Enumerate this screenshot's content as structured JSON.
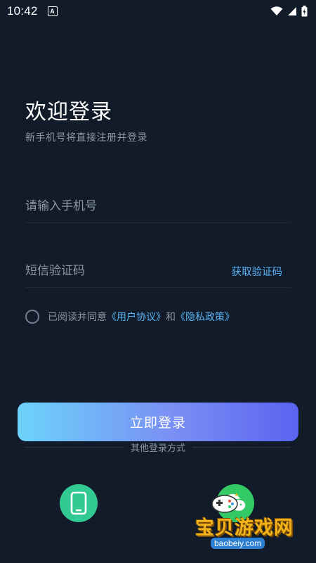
{
  "status_bar": {
    "time": "10:42",
    "notification_letter": "A"
  },
  "header": {
    "title": "欢迎登录",
    "subtitle": "新手机号将直接注册并登录"
  },
  "form": {
    "phone_placeholder": "请输入手机号",
    "code_placeholder": "短信验证码",
    "get_code_label": "获取验证码"
  },
  "agreement": {
    "prefix": "已阅读并同意",
    "user_agreement": "《用户协议》",
    "conjunction": "和",
    "privacy_policy": "《隐私政策》"
  },
  "login_button": {
    "label": "立即登录"
  },
  "other_login": {
    "label": "其他登录方式",
    "methods": [
      {
        "icon": "phone-icon",
        "color": "#33c993"
      },
      {
        "icon": "wechat-icon",
        "color": "#33c964"
      }
    ]
  },
  "watermark": {
    "text": "宝贝游戏网",
    "domain": "baobeiy.com"
  },
  "colors": {
    "background": "#111b29",
    "accent": "#5ab3f5",
    "button_gradient_start": "#6dd3fb",
    "button_gradient_end": "#5a63f0"
  }
}
